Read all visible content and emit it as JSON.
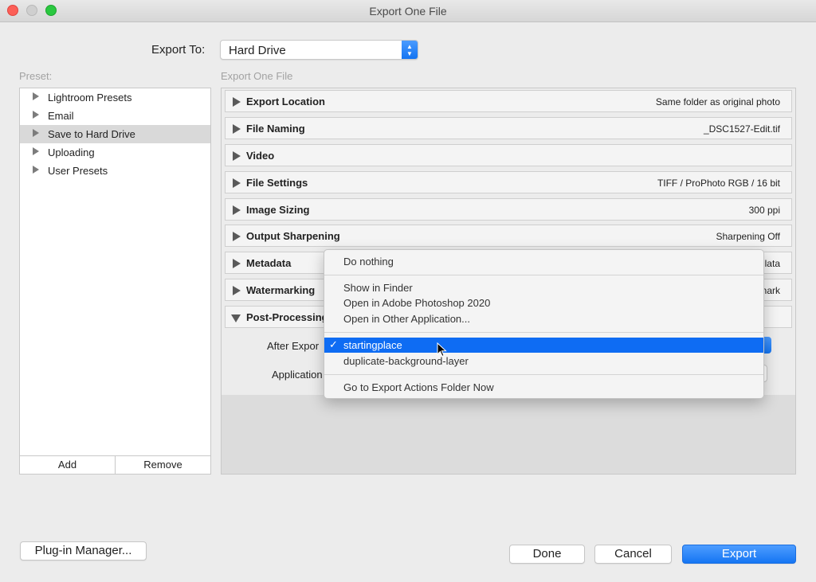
{
  "window": {
    "title": "Export One File"
  },
  "export_to": {
    "label": "Export To:",
    "value": "Hard Drive"
  },
  "preset": {
    "header": "Preset:",
    "items": [
      {
        "label": "Lightroom Presets",
        "selected": false
      },
      {
        "label": "Email",
        "selected": false
      },
      {
        "label": "Save to Hard Drive",
        "selected": true
      },
      {
        "label": "Uploading",
        "selected": false
      },
      {
        "label": "User Presets",
        "selected": false
      }
    ],
    "add_label": "Add",
    "remove_label": "Remove"
  },
  "right": {
    "header": "Export One File",
    "sections": [
      {
        "name": "Export Location",
        "summary": "Same folder as original photo"
      },
      {
        "name": "File Naming",
        "summary": "_DSC1527-Edit.tif"
      },
      {
        "name": "Video",
        "summary": ""
      },
      {
        "name": "File Settings",
        "summary": "TIFF / ProPhoto RGB / 16 bit"
      },
      {
        "name": "Image Sizing",
        "summary": "300 ppi"
      },
      {
        "name": "Output Sharpening",
        "summary": "Sharpening Off"
      },
      {
        "name": "Metadata",
        "summary": "lata"
      },
      {
        "name": "Watermarking",
        "summary": "nark"
      },
      {
        "name": "Post-Processing",
        "summary": ""
      }
    ],
    "after_export_label": "After Expor",
    "application_label": "Application"
  },
  "menu": {
    "items": [
      {
        "label": "Do nothing"
      },
      {
        "label": "Show in Finder"
      },
      {
        "label": "Open in Adobe Photoshop 2020"
      },
      {
        "label": "Open in Other Application..."
      },
      {
        "label": "startingplace",
        "checked": true
      },
      {
        "label": "duplicate-background-layer"
      },
      {
        "label": "Go to Export Actions Folder Now"
      }
    ],
    "check_glyph": "✓"
  },
  "buttons": {
    "plugin_manager": "Plug-in Manager...",
    "done": "Done",
    "cancel": "Cancel",
    "export": "Export"
  },
  "colors": {
    "accent": "#1575f3",
    "selected_row": "#d9d9d9"
  }
}
